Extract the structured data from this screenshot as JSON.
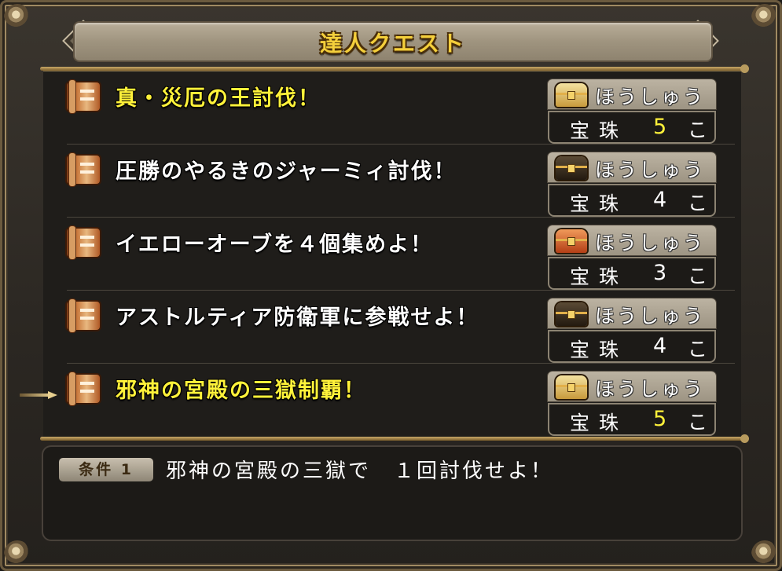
{
  "window": {
    "title": "達人クエスト"
  },
  "quests": [
    {
      "title": "真・災厄の王討伐！",
      "highlight": true,
      "chest": "gold",
      "reward_label": "ほうしゅう",
      "reward_item": "宝珠",
      "reward_count": "5",
      "reward_unit": "こ"
    },
    {
      "title": "圧勝のやるきのジャーミィ討伐！",
      "highlight": false,
      "chest": "black",
      "reward_label": "ほうしゅう",
      "reward_item": "宝珠",
      "reward_count": "4",
      "reward_unit": "こ"
    },
    {
      "title": "イエローオーブを４個集めよ！",
      "highlight": false,
      "chest": "red",
      "reward_label": "ほうしゅう",
      "reward_item": "宝珠",
      "reward_count": "3",
      "reward_unit": "こ"
    },
    {
      "title": "アストルティア防衛軍に参戦せよ！",
      "highlight": false,
      "chest": "black",
      "reward_label": "ほうしゅう",
      "reward_item": "宝珠",
      "reward_count": "4",
      "reward_unit": "こ"
    },
    {
      "title": "邪神の宮殿の三獄制覇！",
      "highlight": true,
      "chest": "gold",
      "reward_label": "ほうしゅう",
      "reward_item": "宝珠",
      "reward_count": "5",
      "reward_unit": "こ",
      "selected": true
    }
  ],
  "condition": {
    "badge": "条件 1",
    "text": "邪神の宮殿の三獄で　１回討伐せよ！"
  },
  "colors": {
    "highlight_text": "#fff23a",
    "title_gold": "#f4cf3b",
    "frame": "#6b5a3e"
  }
}
